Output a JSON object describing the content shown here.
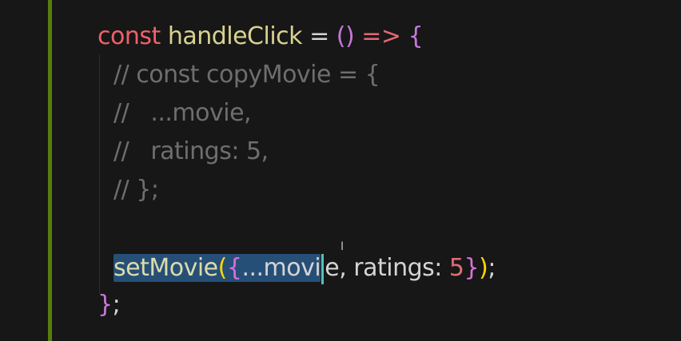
{
  "editor": {
    "language": "javascript",
    "colors": {
      "background": "#171717",
      "git_gutter": "#587c0c",
      "selection": "#264f78",
      "cursor": "#52c3b9"
    },
    "lines": {
      "l1": {
        "kw": "const",
        "name": "handleClick",
        "eq": "=",
        "parens": "()",
        "arrow": "=>",
        "brace": "{"
      },
      "l2": "// const copyMovie = {",
      "l3": "//   ...movie,",
      "l4": "//   ratings: 5,",
      "l5": "// };",
      "l7": {
        "fn": "setMovie",
        "open_paren": "(",
        "open_brace": "{",
        "spread": "...movi",
        "after_cursor": "e",
        "rest": ", ratings: ",
        "num": "5",
        "close_brace": "}",
        "close_paren": ")",
        "semi": ";"
      },
      "l8": {
        "brace": "}",
        "semi": ";"
      }
    },
    "pointer": "I"
  }
}
